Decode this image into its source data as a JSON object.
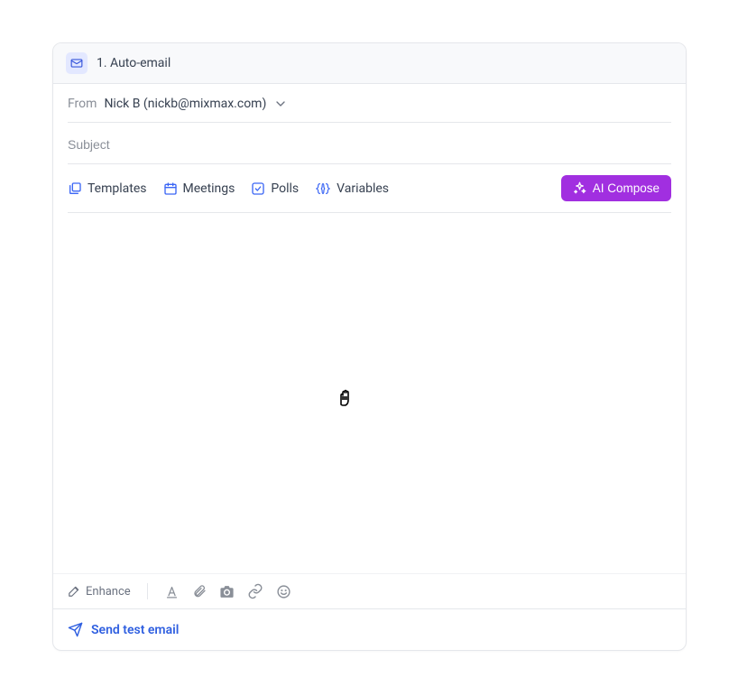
{
  "header": {
    "title": "1. Auto-email"
  },
  "from": {
    "label": "From",
    "value": "Nick B (nickb@mixmax.com)"
  },
  "subject": {
    "placeholder": "Subject",
    "value": ""
  },
  "toolbar": {
    "templates": "Templates",
    "meetings": "Meetings",
    "polls": "Polls",
    "variables": "Variables",
    "ai_compose": "AI Compose"
  },
  "bottom": {
    "enhance": "Enhance"
  },
  "footer": {
    "send_test": "Send test email"
  }
}
